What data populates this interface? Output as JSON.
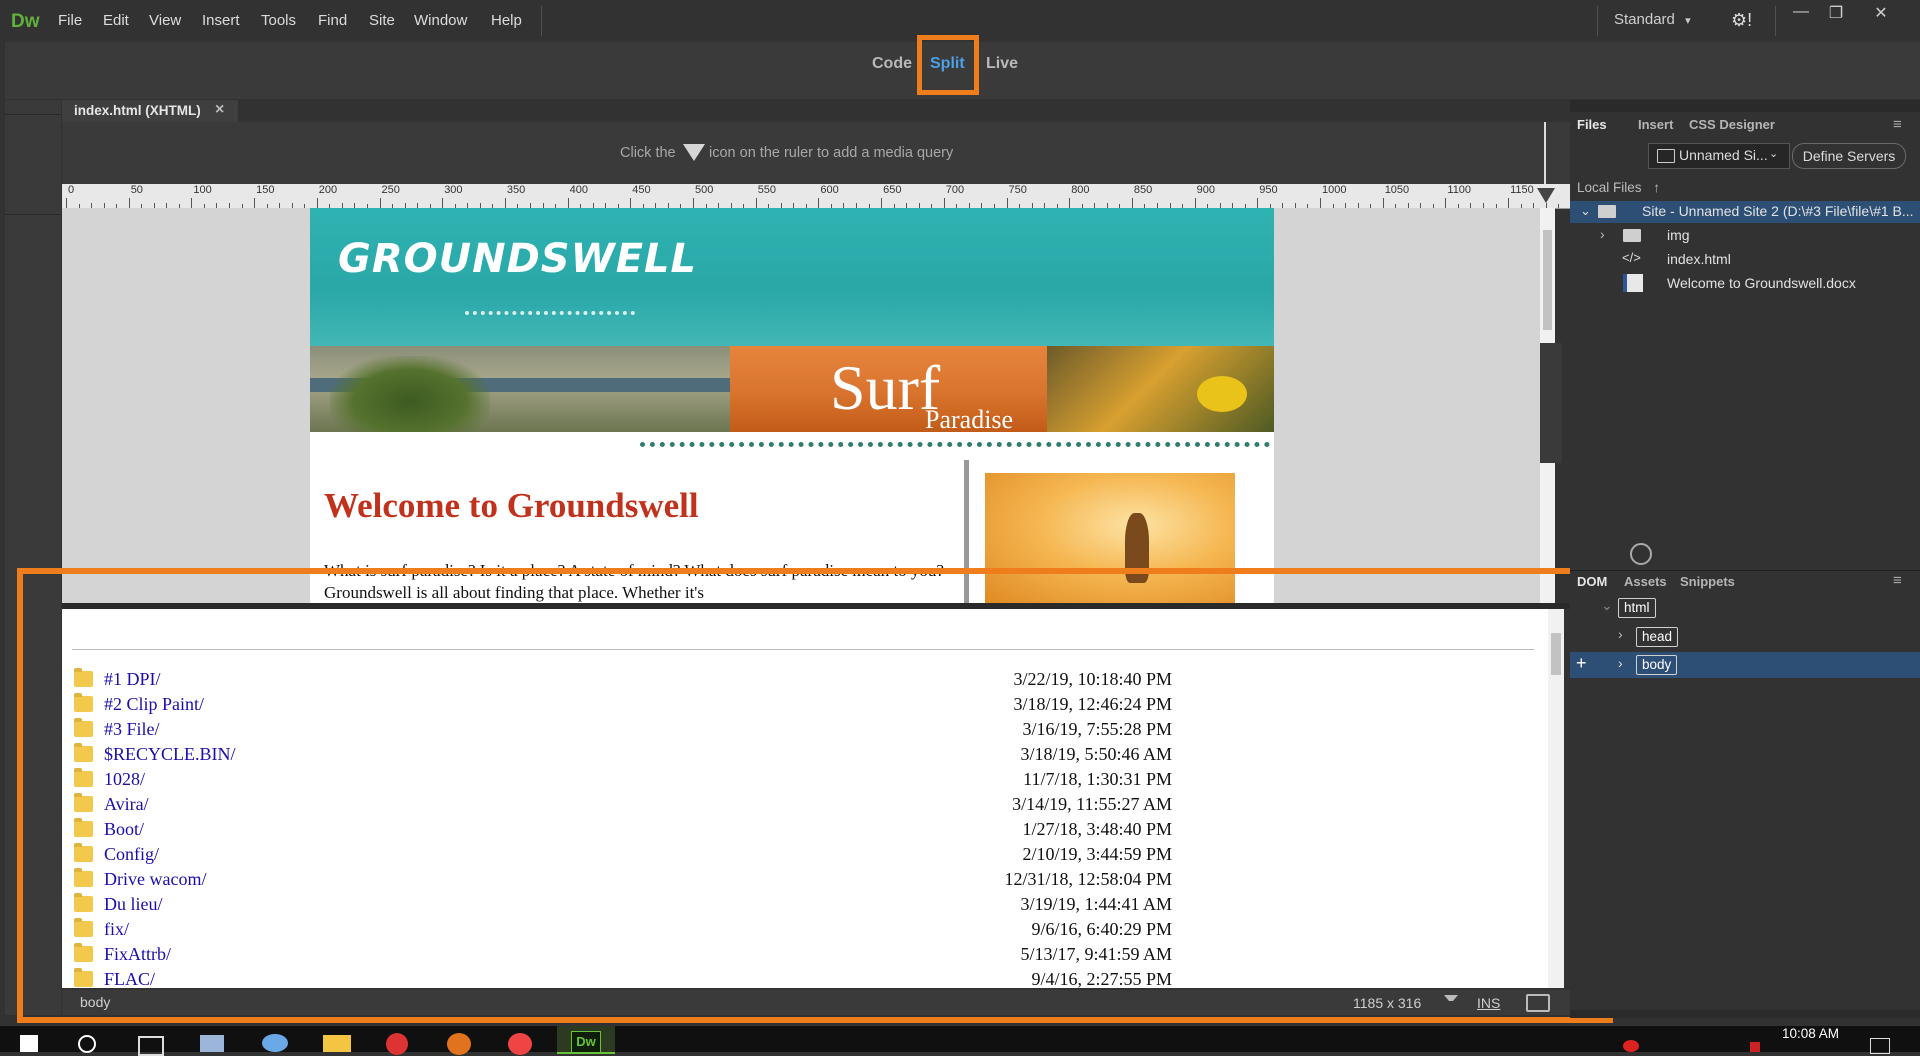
{
  "app": {
    "logo": "Dw",
    "menu": [
      "File",
      "Edit",
      "View",
      "Insert",
      "Tools",
      "Find",
      "Site",
      "Window",
      "Help"
    ],
    "workspace": "Standard",
    "workspace_caret": "▾",
    "gear": "⚙!",
    "window_controls": [
      "—",
      "❐",
      "✕"
    ]
  },
  "viewbar": {
    "code": "Code",
    "split": "Split",
    "live": "Live"
  },
  "doc": {
    "tab": "index.html (XHTML)",
    "close": "×",
    "mq_before": "Click the",
    "mq_after": "icon on the ruler to add a media query",
    "ruler_labels": [
      "0",
      "50",
      "100",
      "150",
      "200",
      "250",
      "300",
      "350",
      "400",
      "450",
      "500",
      "550",
      "600",
      "650",
      "700",
      "750",
      "800",
      "850",
      "900",
      "950",
      "1000",
      "1050",
      "1100",
      "1150"
    ]
  },
  "design": {
    "logo": "GROUNDSWELL",
    "surf": "Surf",
    "paradise": "Paradise",
    "heading": "Welcome to Groundswell",
    "intro": "What is surf paradise? Is it a place? A state of mind? What does surf paradise mean to you? Groundswell is all about finding that place. Whether it's"
  },
  "listing": {
    "rows": [
      {
        "name": "#1 DPI/",
        "date": "3/22/19, 10:18:40 PM"
      },
      {
        "name": "#2 Clip Paint/",
        "date": "3/18/19, 12:46:24 PM"
      },
      {
        "name": "#3 File/",
        "date": "3/16/19, 7:55:28 PM"
      },
      {
        "name": "$RECYCLE.BIN/",
        "date": "3/18/19, 5:50:46 AM"
      },
      {
        "name": "1028/",
        "date": "11/7/18, 1:30:31 PM"
      },
      {
        "name": "Avira/",
        "date": "3/14/19, 11:55:27 AM"
      },
      {
        "name": "Boot/",
        "date": "1/27/18, 3:48:40 PM"
      },
      {
        "name": "Config/",
        "date": "2/10/19, 3:44:59 PM"
      },
      {
        "name": "Drive wacom/",
        "date": "12/31/18, 12:58:04 PM"
      },
      {
        "name": "Du lieu/",
        "date": "3/19/19, 1:44:41 AM"
      },
      {
        "name": "fix/",
        "date": "9/6/16, 6:40:29 PM"
      },
      {
        "name": "FixAttrb/",
        "date": "5/13/17, 9:41:59 AM"
      },
      {
        "name": "FLAC/",
        "date": "9/4/16, 2:27:55 PM"
      }
    ]
  },
  "status": {
    "tag": "body",
    "size": "1185 x 316",
    "ins": "INS"
  },
  "files_panel": {
    "tabs": [
      "Files",
      "Insert",
      "CSS Designer"
    ],
    "site_select": "Unnamed Si...",
    "define_servers": "Define Servers",
    "local_files": "Local Files",
    "site_row": "Site - Unnamed Site 2 (D:\\#3 File\\file\\#1 B...",
    "items": [
      "img",
      "index.html",
      "Welcome to Groundswell.docx"
    ]
  },
  "dom_panel": {
    "tabs": [
      "DOM",
      "Assets",
      "Snippets"
    ],
    "nodes": [
      "html",
      "head",
      "body"
    ]
  },
  "taskbar": {
    "clock": "10:08 AM"
  }
}
